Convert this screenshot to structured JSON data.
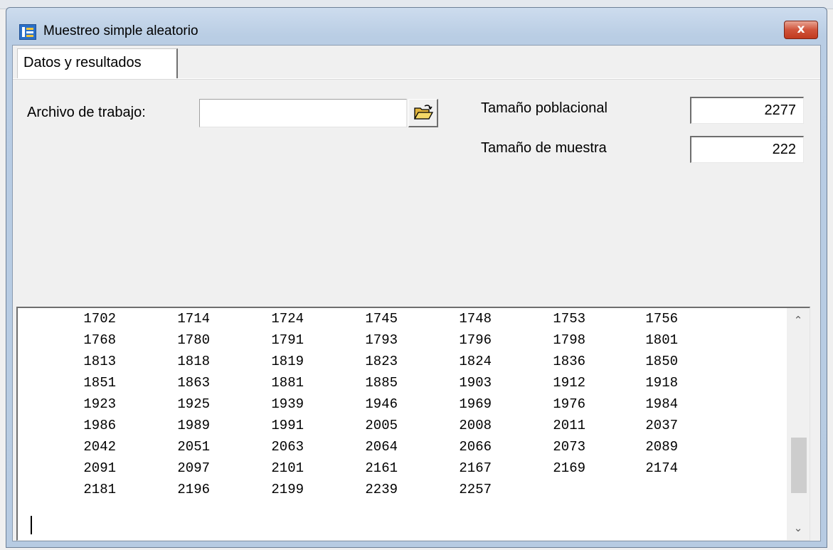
{
  "window": {
    "title": "Muestreo simple aleatorio",
    "close_label": "x"
  },
  "tabs": [
    {
      "label": "Datos y resultados",
      "active": true
    }
  ],
  "form": {
    "archivo_label": "Archivo de trabajo:",
    "archivo_value": "",
    "poblacional_label": "Tamaño poblacional",
    "poblacional_value": "2277",
    "muestra_label": "Tamaño de muestra",
    "muestra_value": "222"
  },
  "icons": {
    "app": "app-e-icon",
    "open": "open-folder-icon",
    "scroll_up": "chevron-up-icon",
    "scroll_down": "chevron-down-icon"
  },
  "output": {
    "rows": [
      [
        "1702",
        "1714",
        "1724",
        "1745",
        "1748",
        "1753",
        "1756"
      ],
      [
        "1768",
        "1780",
        "1791",
        "1793",
        "1796",
        "1798",
        "1801"
      ],
      [
        "1813",
        "1818",
        "1819",
        "1823",
        "1824",
        "1836",
        "1850"
      ],
      [
        "1851",
        "1863",
        "1881",
        "1885",
        "1903",
        "1912",
        "1918"
      ],
      [
        "1923",
        "1925",
        "1939",
        "1946",
        "1969",
        "1976",
        "1984"
      ],
      [
        "1986",
        "1989",
        "1991",
        "2005",
        "2008",
        "2011",
        "2037"
      ],
      [
        "2042",
        "2051",
        "2063",
        "2064",
        "2066",
        "2073",
        "2089"
      ],
      [
        "2091",
        "2097",
        "2101",
        "2161",
        "2167",
        "2169",
        "2174"
      ],
      [
        "2181",
        "2196",
        "2199",
        "2239",
        "2257"
      ]
    ],
    "scroll_position_fraction": 0.82
  },
  "colors": {
    "close_button": "#c8472d",
    "titlebar": "#c2d5ea"
  }
}
